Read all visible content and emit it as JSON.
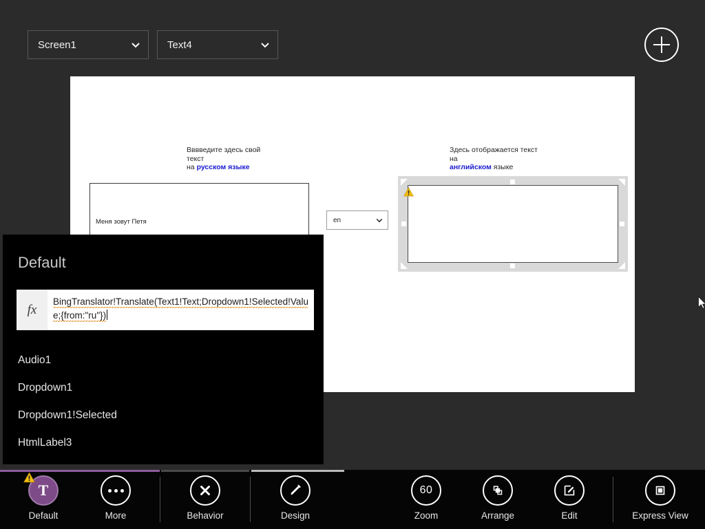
{
  "header": {
    "screen_selector": {
      "value": "Screen1",
      "icon": "chevron-down-icon"
    },
    "control_selector": {
      "value": "Text4",
      "icon": "chevron-down-icon"
    },
    "add_button": {
      "icon": "plus-icon"
    }
  },
  "canvas": {
    "label_ru": {
      "line1": "Вввведите здесь свой текст",
      "plain": "на ",
      "bold": "русском языке"
    },
    "label_en": {
      "line1": "Здесь отображается текст на",
      "bold": "английском",
      "plain": " языке"
    },
    "input_textbox": {
      "value": "Меня зовут Петя"
    },
    "language_dropdown": {
      "value": "en",
      "icon": "chevron-down-icon"
    },
    "output_textbox": {
      "value": "",
      "warning_icon": "warning-triangle-icon"
    }
  },
  "formula_panel": {
    "property_name": "Default",
    "fx_icon": "fx-icon",
    "formula_part1": "BingTranslator!Translate(Text1!Text;Dropdown1!",
    "formula_part2": "Selected!Value;{from:\"ru\"})",
    "autocomplete": [
      {
        "label": "Audio1"
      },
      {
        "label": "Dropdown1"
      },
      {
        "label": "Dropdown1!Selected"
      },
      {
        "label": "HtmlLabel3"
      }
    ]
  },
  "toolbar": {
    "items": [
      {
        "label": "Default",
        "icon": "text-control-icon",
        "glyph": "T",
        "badge": "warning-triangle-icon"
      },
      {
        "label": "More",
        "icon": "ellipsis-icon"
      },
      {
        "label": "Behavior",
        "icon": "behavior-arrows-icon"
      },
      {
        "label": "Design",
        "icon": "pencil-icon"
      },
      {
        "label": "Zoom",
        "icon": "zoom-level-icon",
        "value": "60"
      },
      {
        "label": "Arrange",
        "icon": "arrange-squares-icon"
      },
      {
        "label": "Edit",
        "icon": "edit-pencil-square-icon"
      },
      {
        "label": "Express View",
        "icon": "express-view-icon"
      }
    ]
  },
  "colors": {
    "app_background": "#2b2b2b",
    "panel_background": "#000000",
    "canvas_background": "#ffffff",
    "accent_purple": "#7d4b87",
    "rule_purple": "#8d5c9b",
    "link_blue": "#1a1ad0",
    "warning_yellow": "#f2c010",
    "squiggle_orange": "#e08a1e"
  },
  "cursor": {
    "icon": "mouse-pointer-icon"
  }
}
